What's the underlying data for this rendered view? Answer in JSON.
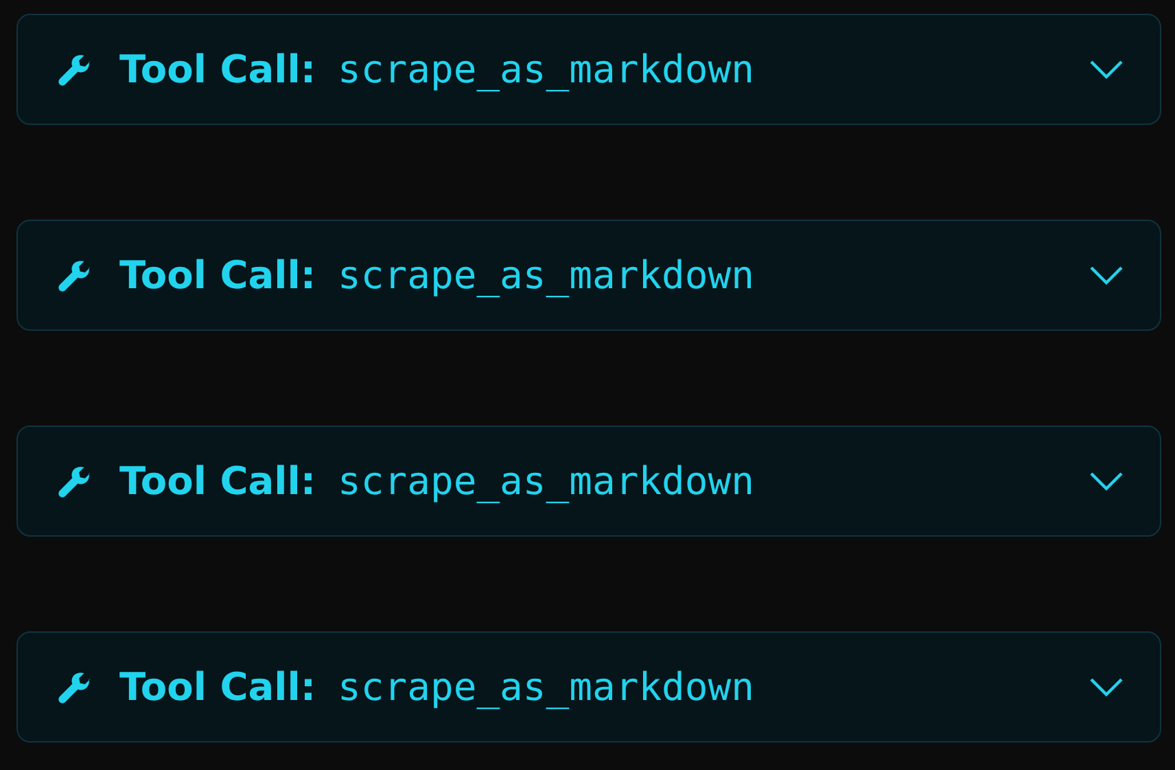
{
  "tool_calls": [
    {
      "label": "Tool Call:",
      "name": "scrape_as_markdown",
      "expanded": false
    },
    {
      "label": "Tool Call:",
      "name": "scrape_as_markdown",
      "expanded": false
    },
    {
      "label": "Tool Call:",
      "name": "scrape_as_markdown",
      "expanded": false
    },
    {
      "label": "Tool Call:",
      "name": "scrape_as_markdown",
      "expanded": false
    }
  ]
}
